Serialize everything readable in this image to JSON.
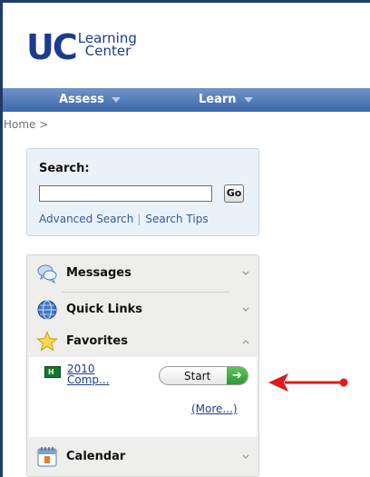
{
  "logo": {
    "uc": "UC",
    "word1": "Learning",
    "word2": "Center"
  },
  "nav": {
    "items": [
      {
        "label": "Assess"
      },
      {
        "label": "Learn"
      }
    ]
  },
  "breadcrumb": "Home >",
  "search": {
    "label": "Search:",
    "value": "",
    "go_label": "Go",
    "advanced_label": "Advanced Search",
    "separator": "|",
    "tips_label": "Search Tips"
  },
  "panel": {
    "messages": {
      "title": "Messages",
      "icon": "messages-icon",
      "expanded": false
    },
    "quick_links": {
      "title": "Quick Links",
      "icon": "globe-icon",
      "expanded": false
    },
    "favorites": {
      "title": "Favorites",
      "icon": "star-icon",
      "expanded": true,
      "items": [
        {
          "badge": "H",
          "title": "2010 Comp...",
          "action": "Start"
        }
      ],
      "more_label": "(More...)"
    },
    "calendar": {
      "title": "Calendar",
      "icon": "calendar-icon",
      "expanded": false
    }
  },
  "colors": {
    "brand": "#1d3b8c",
    "nav": "#4a76b4",
    "link": "#1c3d8f",
    "start_green": "#3aa63a",
    "annotation_red": "#e01b1b"
  }
}
